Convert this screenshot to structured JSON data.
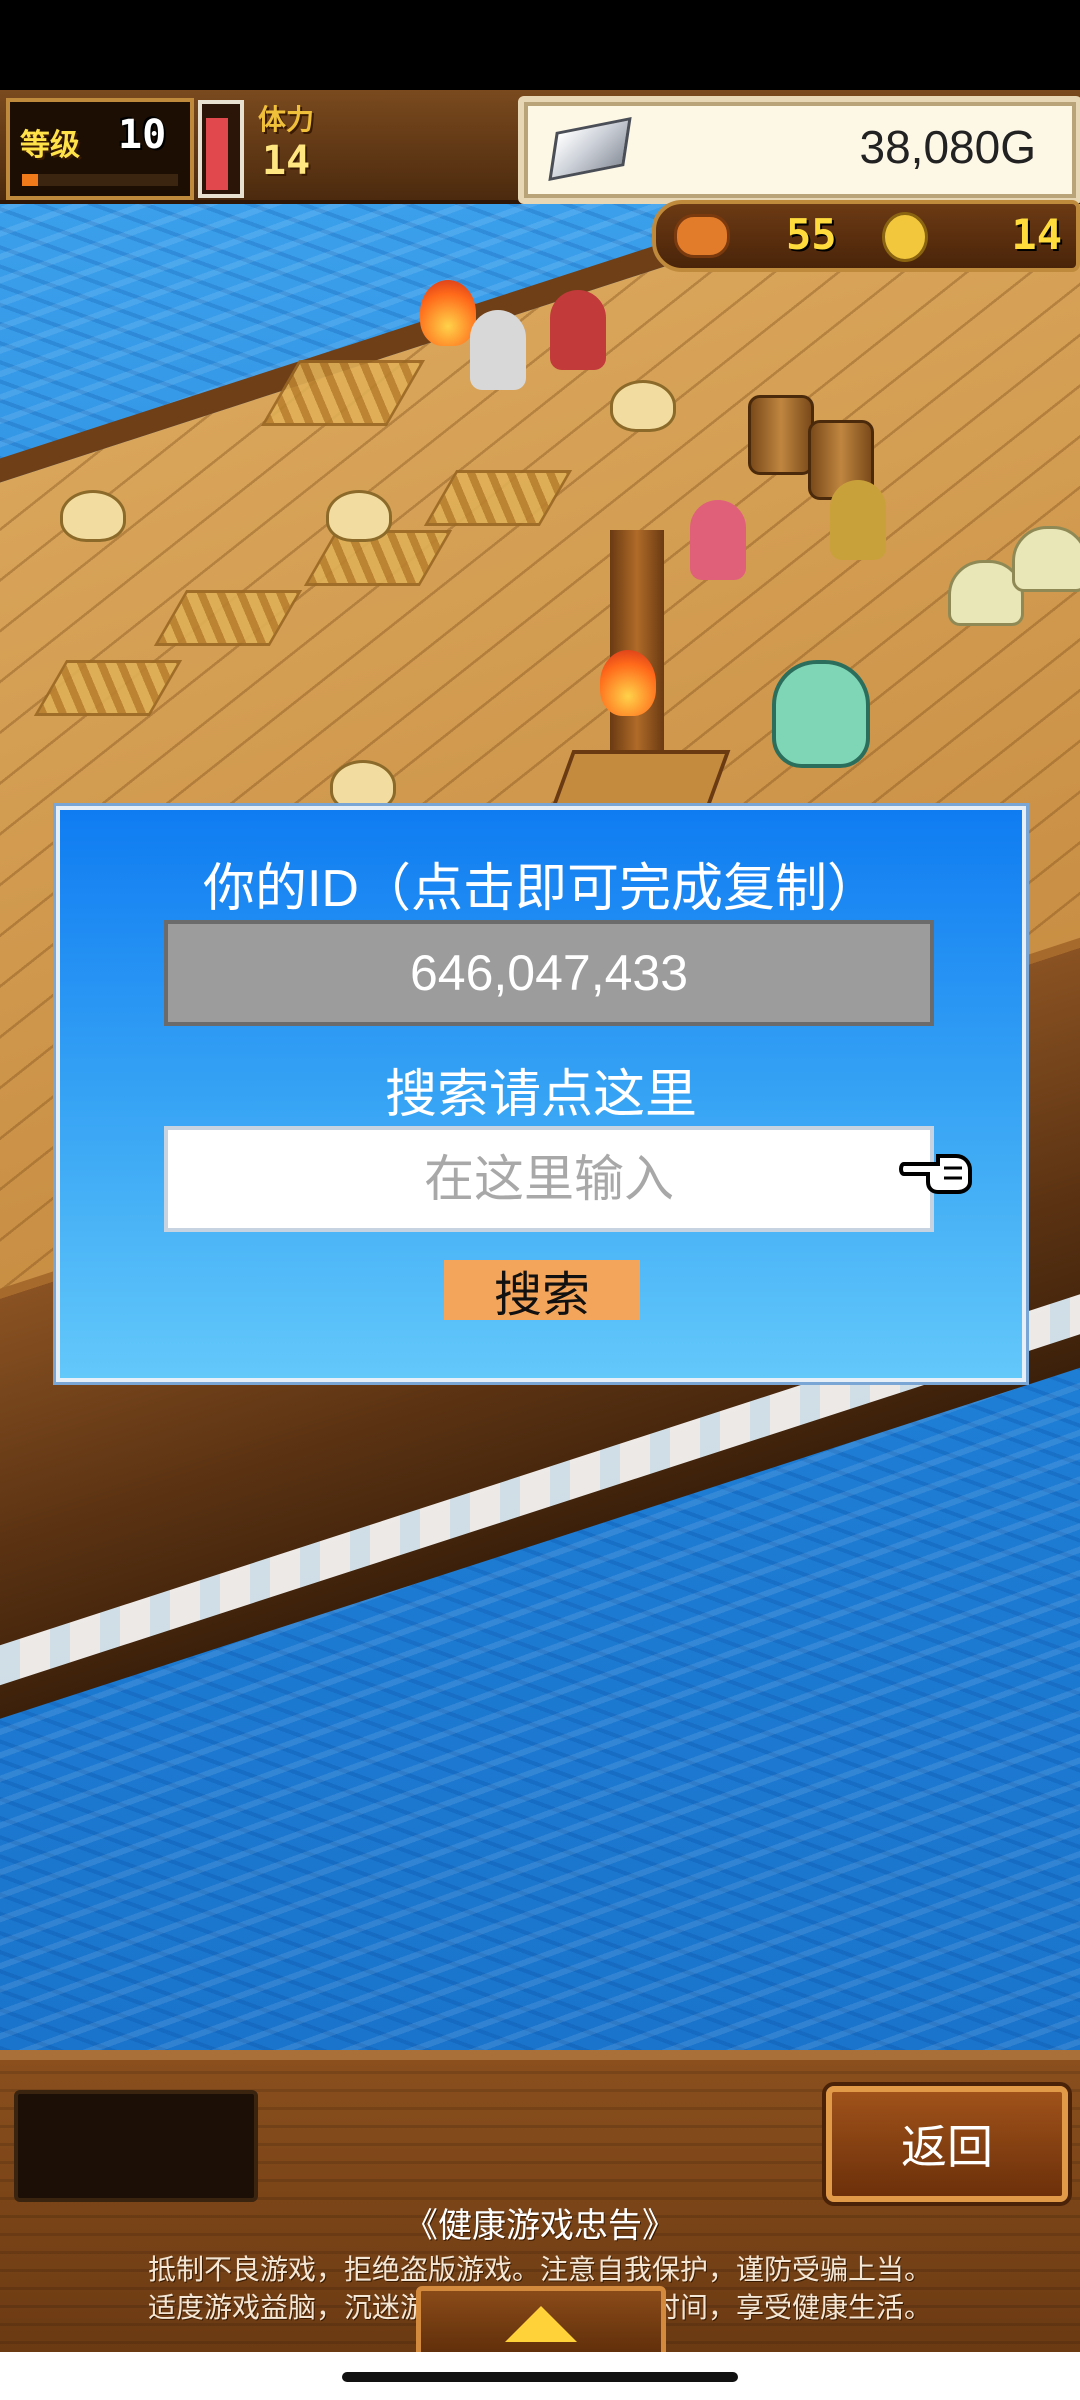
{
  "hud": {
    "level_label": "等级",
    "level_value": "10",
    "stamina_label": "体力",
    "stamina_value": "14",
    "money": "38,080G",
    "food_value": "55",
    "medal_value": "14"
  },
  "dialog": {
    "title": "你的ID（点击即可完成复制）",
    "user_id": "646,047,433",
    "search_label": "搜索请点这里",
    "input_placeholder": "在这里输入",
    "input_value": "",
    "search_button": "搜索"
  },
  "bottom": {
    "back_button": "返回",
    "notice_title": "《健康游戏忠告》",
    "notice_line1": "抵制不良游戏，拒绝盗版游戏。注意自我保护，谨防受骗上当。",
    "notice_line2": "适度游戏益脑，沉迷游戏伤身。合理安排时间，享受健康生活。"
  },
  "icons": {
    "silver": "silver-ingot-icon",
    "food": "food-icon",
    "coin": "medal-coin-icon",
    "pointer": "pointing-hand-icon",
    "expand": "arrow-up-icon"
  }
}
